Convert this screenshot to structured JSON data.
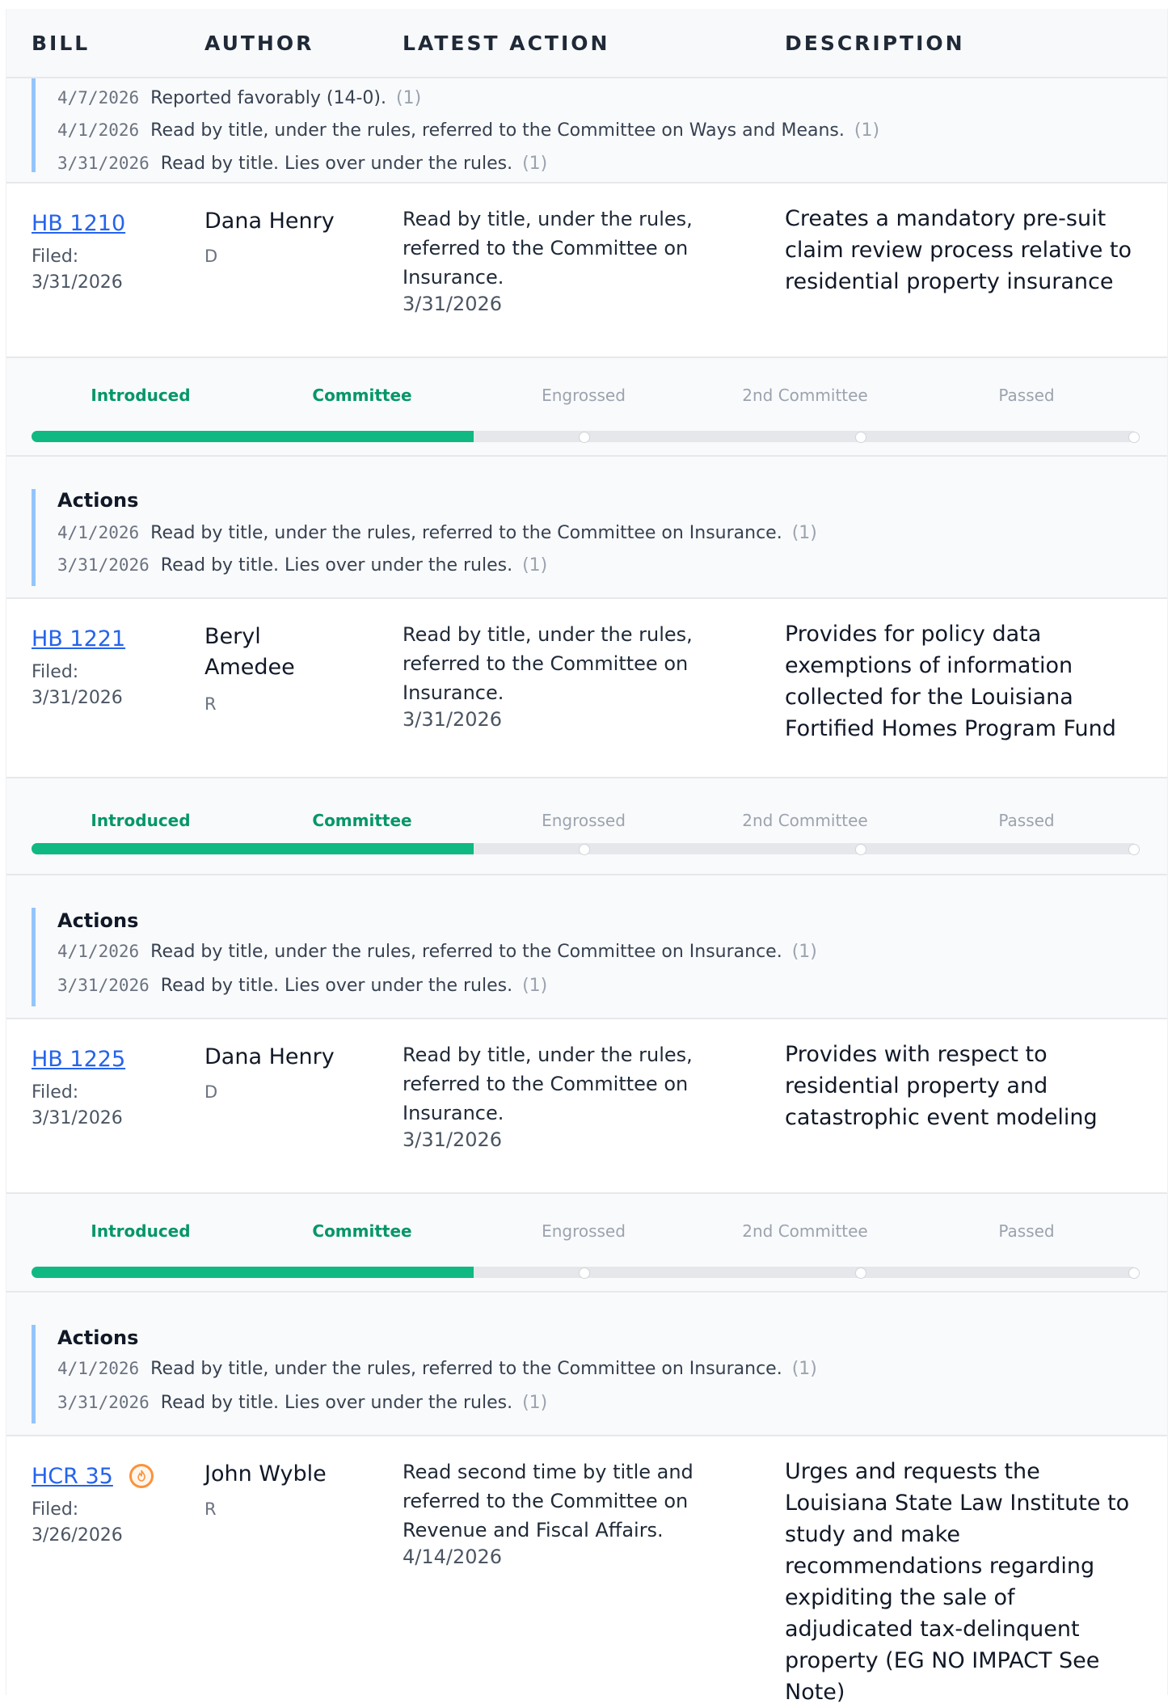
{
  "header": {
    "bill": "BILL",
    "author": "AUTHOR",
    "latest_action": "LATEST ACTION",
    "description": "DESCRIPTION"
  },
  "stages": [
    "Introduced",
    "Committee",
    "Engrossed",
    "2nd Committee",
    "Passed"
  ],
  "actions_title": "Actions",
  "top_actions": [
    {
      "date": "4/7/2026",
      "text": "Reported favorably (14-0).",
      "count": "(1)"
    },
    {
      "date": "4/1/2026",
      "text": "Read by title, under the rules, referred to the Committee on Ways and Means.",
      "count": "(1)"
    },
    {
      "date": "3/31/2026",
      "text": "Read by title. Lies over under the rules.",
      "count": "(1)"
    }
  ],
  "bills": [
    {
      "id": "HB 1210",
      "filed_label": "Filed:",
      "filed_date": "3/31/2026",
      "author": "Dana Henry",
      "party": "D",
      "latest_action": "Read by title, under the rules, referred to the Committee on Insurance.",
      "latest_date": "3/31/2026",
      "description": "Creates a mandatory pre-suit claim review process relative to residential property insurance",
      "progress_fraction": 0.4,
      "actions": [
        {
          "date": "4/1/2026",
          "text": "Read by title, under the rules, referred to the Committee on Insurance.",
          "count": "(1)"
        },
        {
          "date": "3/31/2026",
          "text": "Read by title. Lies over under the rules.",
          "count": "(1)"
        }
      ]
    },
    {
      "id": "HB 1221",
      "filed_label": "Filed:",
      "filed_date": "3/31/2026",
      "author": "Beryl Amedee",
      "party": "R",
      "latest_action": "Read by title, under the rules, referred to the Committee on Insurance.",
      "latest_date": "3/31/2026",
      "description": "Provides for policy data exemptions of information collected for the Louisiana Fortified Homes Program Fund",
      "progress_fraction": 0.4,
      "actions": [
        {
          "date": "4/1/2026",
          "text": "Read by title, under the rules, referred to the Committee on Insurance.",
          "count": "(1)"
        },
        {
          "date": "3/31/2026",
          "text": "Read by title. Lies over under the rules.",
          "count": "(1)"
        }
      ]
    },
    {
      "id": "HB 1225",
      "filed_label": "Filed:",
      "filed_date": "3/31/2026",
      "author": "Dana Henry",
      "party": "D",
      "latest_action": "Read by title, under the rules, referred to the Committee on Insurance.",
      "latest_date": "3/31/2026",
      "description": "Provides with respect to residential property and catastrophic event modeling",
      "progress_fraction": 0.4,
      "actions": [
        {
          "date": "4/1/2026",
          "text": "Read by title, under the rules, referred to the Committee on Insurance.",
          "count": "(1)"
        },
        {
          "date": "3/31/2026",
          "text": "Read by title. Lies over under the rules.",
          "count": "(1)"
        }
      ]
    },
    {
      "id": "HCR 35",
      "filed_label": "Filed:",
      "filed_date": "3/26/2026",
      "author": "John Wyble",
      "party": "R",
      "latest_action": "Read second time by title and referred to the Committee on Revenue and Fiscal Affairs.",
      "latest_date": "4/14/2026",
      "description": "Urges and requests the Louisiana State Law Institute to study and make recommendations regarding expiditing the sale of adjudicated tax-delinquent property (EG NO IMPACT See Note)",
      "hot_icon": "flame-icon"
    }
  ],
  "colors": {
    "link": "#2563eb",
    "progress_fill": "#10b981",
    "stage_done": "#059669",
    "actions_border": "#93c5fd"
  }
}
